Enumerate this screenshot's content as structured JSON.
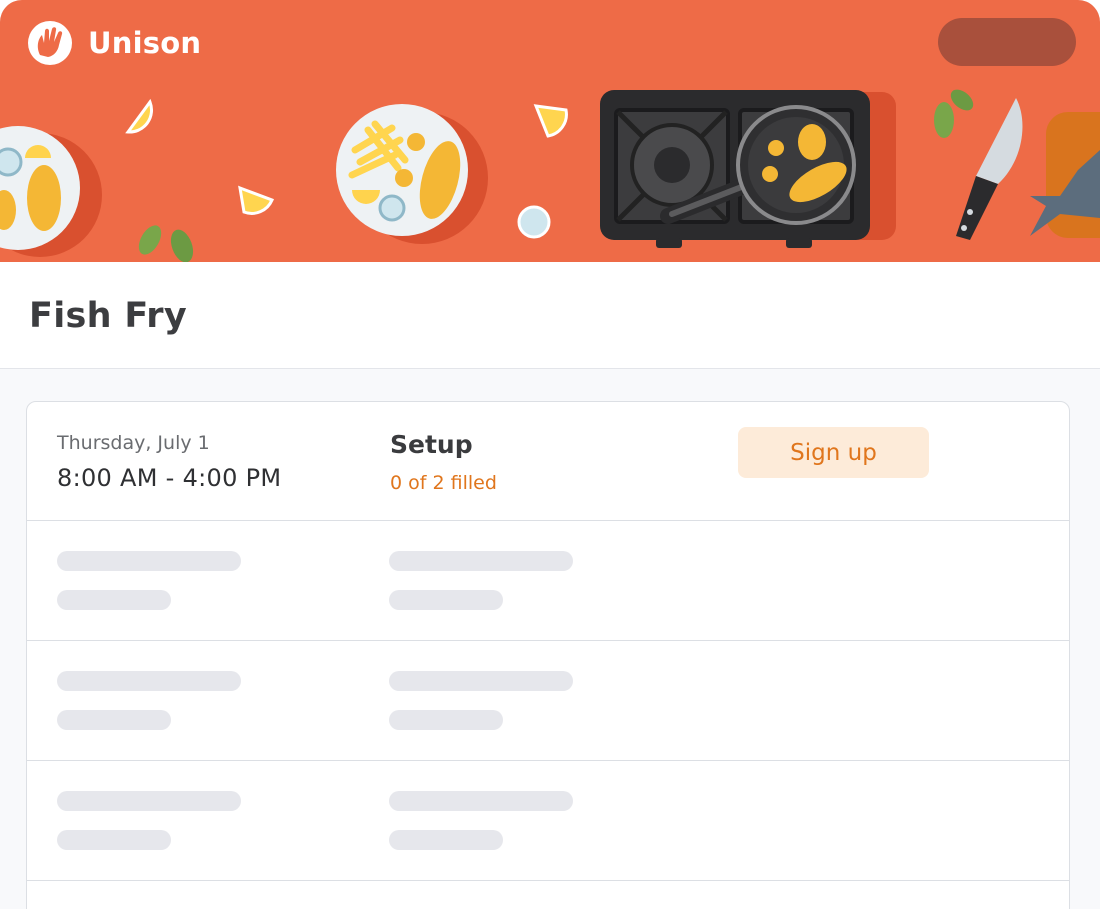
{
  "app": {
    "name": "Unison"
  },
  "event": {
    "title": "Fish Fry"
  },
  "colors": {
    "brand": "#ee6b47",
    "accent": "#e0761d",
    "accent_bg": "#fdebd9"
  },
  "slots": [
    {
      "date": "Thursday, July 1",
      "time": "8:00 AM - 4:00 PM",
      "role": "Setup",
      "filled": "0 of 2 filled",
      "action_label": "Sign up"
    }
  ],
  "icons": {
    "logo": "waving-hand-icon",
    "account": "account-menu-pill"
  }
}
